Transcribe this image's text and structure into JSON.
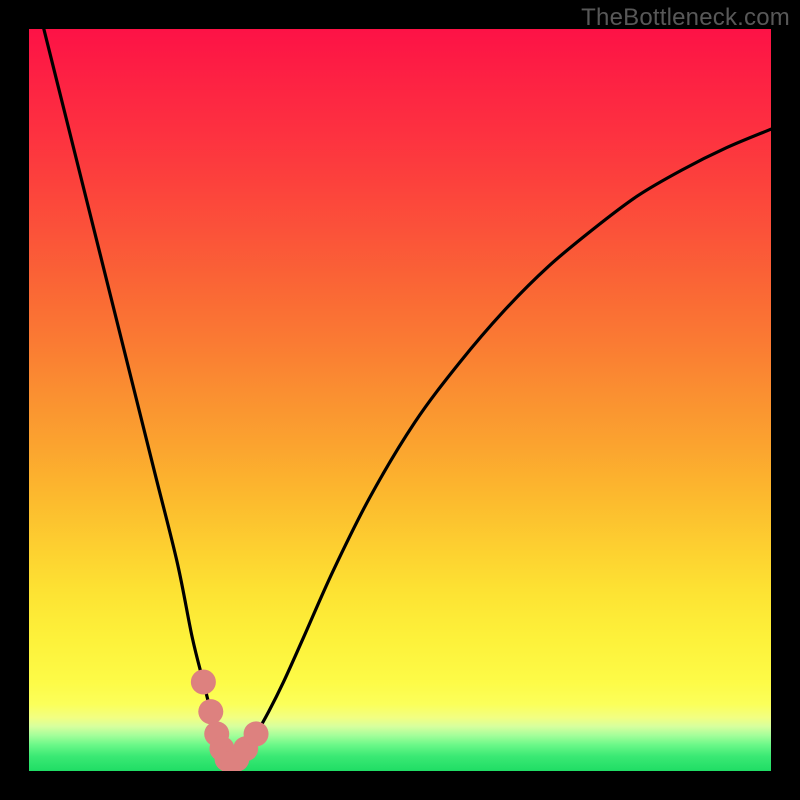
{
  "watermark": "TheBottleneck.com",
  "colors": {
    "frame": "#000000",
    "curve": "#000000",
    "marker": "#dd817f",
    "watermark": "#585858",
    "gradient_stops": [
      {
        "offset": 0.0,
        "color": "#fd1246"
      },
      {
        "offset": 0.07,
        "color": "#fd2243"
      },
      {
        "offset": 0.14,
        "color": "#fd3140"
      },
      {
        "offset": 0.21,
        "color": "#fc423c"
      },
      {
        "offset": 0.28,
        "color": "#fb5439"
      },
      {
        "offset": 0.35,
        "color": "#fa6735"
      },
      {
        "offset": 0.42,
        "color": "#fa7a33"
      },
      {
        "offset": 0.49,
        "color": "#fa8f31"
      },
      {
        "offset": 0.56,
        "color": "#fba32f"
      },
      {
        "offset": 0.63,
        "color": "#fcb92e"
      },
      {
        "offset": 0.7,
        "color": "#fdd030"
      },
      {
        "offset": 0.76,
        "color": "#fde333"
      },
      {
        "offset": 0.82,
        "color": "#fdf13a"
      },
      {
        "offset": 0.88,
        "color": "#fdfb47"
      },
      {
        "offset": 0.91,
        "color": "#fbff5a"
      },
      {
        "offset": 0.928,
        "color": "#f2ff82"
      },
      {
        "offset": 0.94,
        "color": "#d7ff9e"
      },
      {
        "offset": 0.952,
        "color": "#a4fe9a"
      },
      {
        "offset": 0.965,
        "color": "#6af888"
      },
      {
        "offset": 0.98,
        "color": "#3be974"
      },
      {
        "offset": 1.0,
        "color": "#1fdd65"
      }
    ]
  },
  "chart_data": {
    "type": "line",
    "title": "",
    "xlabel": "",
    "ylabel": "",
    "xlim": [
      0,
      100
    ],
    "ylim": [
      0,
      100
    ],
    "grid": false,
    "legend": false,
    "x": [
      2,
      5,
      8,
      11,
      14,
      17,
      20,
      22,
      23.5,
      24.5,
      25.3,
      26.0,
      26.7,
      27.3,
      28.0,
      29.2,
      30.6,
      32.3,
      34.3,
      37.0,
      41.0,
      46.0,
      52.0,
      58.0,
      64.0,
      70.0,
      76.0,
      82.0,
      88.0,
      94.0,
      100.0
    ],
    "y": [
      100.0,
      88.0,
      76.0,
      64.0,
      52.0,
      40.0,
      28.0,
      18.0,
      12.0,
      8.0,
      5.0,
      3.0,
      1.6,
      1.1,
      1.6,
      3.0,
      5.0,
      8.0,
      12.0,
      18.0,
      27.0,
      37.0,
      47.0,
      55.0,
      62.0,
      68.0,
      73.0,
      77.5,
      81.0,
      84.0,
      86.5
    ],
    "markers": {
      "x": [
        23.5,
        24.5,
        25.3,
        26.0,
        26.7,
        27.3,
        28.0,
        29.2,
        30.6
      ],
      "y": [
        12.0,
        8.0,
        5.0,
        3.0,
        1.6,
        1.1,
        1.6,
        3.0,
        5.0
      ]
    }
  }
}
